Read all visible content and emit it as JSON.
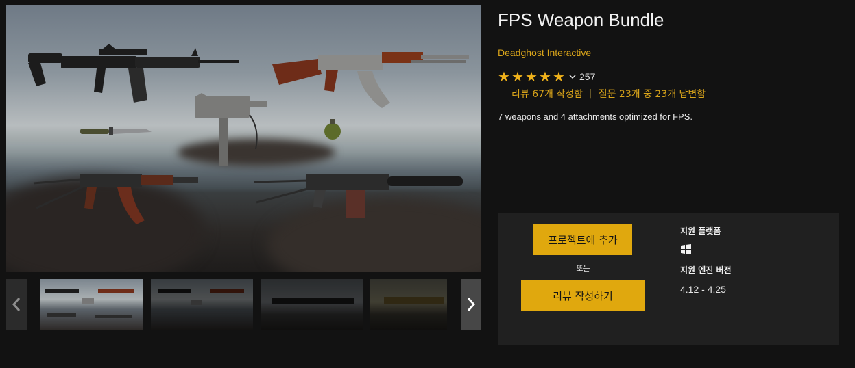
{
  "product": {
    "title": "FPS Weapon Bundle",
    "publisher": "Deadghost Interactive",
    "rating_count": "257",
    "review_link": "리뷰 67개 작성함",
    "qa_link": "질문 23개 중 23개 답변함",
    "description": "7 weapons and 4 attachments optimized for FPS."
  },
  "rating": {
    "stars": 5,
    "max": 5
  },
  "gallery": {
    "thumbnail_count": 4,
    "active_index": 0,
    "prev_icon": "chevron-left-icon",
    "next_icon": "chevron-right-icon"
  },
  "purchase": {
    "add_to_project": "프로젝트에 추가",
    "or": "또는",
    "write_review": "리뷰 작성하기"
  },
  "specs": {
    "platform_label": "지원 플랫폼",
    "platform_icon": "windows-icon",
    "engine_label": "지원 엔진 버전",
    "engine_versions": "4.12 - 4.25"
  },
  "colors": {
    "accent": "#e0a80e",
    "link": "#d9a41a",
    "background": "#121212",
    "panel": "#202020"
  }
}
